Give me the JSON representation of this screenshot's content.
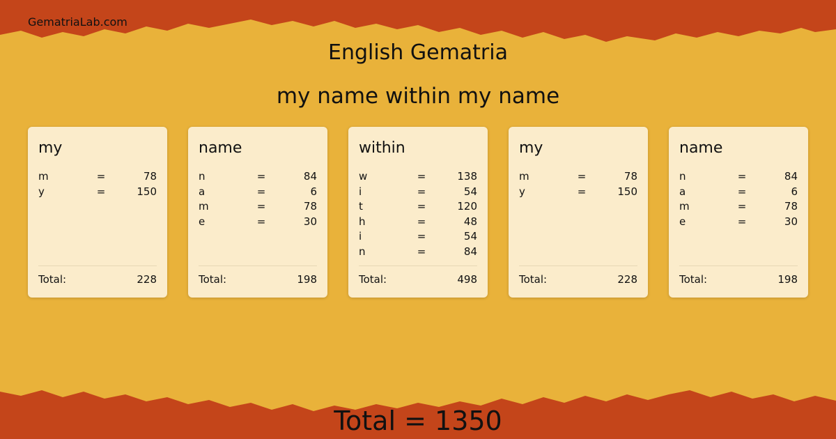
{
  "site": "GematriaLab.com",
  "title": "English Gematria",
  "phrase": "my name within my name",
  "words": [
    {
      "word": "my",
      "letters": [
        {
          "l": "m",
          "v": "78"
        },
        {
          "l": "y",
          "v": "150"
        }
      ],
      "total_label": "Total:",
      "total": "228"
    },
    {
      "word": "name",
      "letters": [
        {
          "l": "n",
          "v": "84"
        },
        {
          "l": "a",
          "v": "6"
        },
        {
          "l": "m",
          "v": "78"
        },
        {
          "l": "e",
          "v": "30"
        }
      ],
      "total_label": "Total:",
      "total": "198"
    },
    {
      "word": "within",
      "letters": [
        {
          "l": "w",
          "v": "138"
        },
        {
          "l": "i",
          "v": "54"
        },
        {
          "l": "t",
          "v": "120"
        },
        {
          "l": "h",
          "v": "48"
        },
        {
          "l": "i",
          "v": "54"
        },
        {
          "l": "n",
          "v": "84"
        }
      ],
      "total_label": "Total:",
      "total": "498"
    },
    {
      "word": "my",
      "letters": [
        {
          "l": "m",
          "v": "78"
        },
        {
          "l": "y",
          "v": "150"
        }
      ],
      "total_label": "Total:",
      "total": "228"
    },
    {
      "word": "name",
      "letters": [
        {
          "l": "n",
          "v": "84"
        },
        {
          "l": "a",
          "v": "6"
        },
        {
          "l": "m",
          "v": "78"
        },
        {
          "l": "e",
          "v": "30"
        }
      ],
      "total_label": "Total:",
      "total": "198"
    }
  ],
  "equals_sign": "=",
  "grand_total": "Total = 1350",
  "colors": {
    "background": "#e9b23a",
    "border": "#c8481a",
    "card": "#fbeccb"
  }
}
